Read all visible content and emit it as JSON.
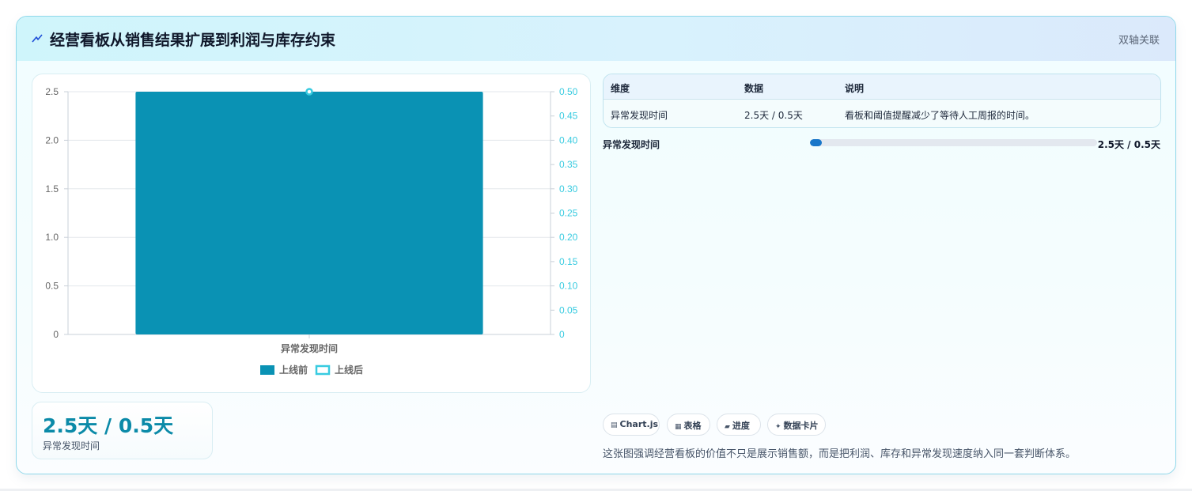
{
  "header": {
    "icon": "spark-icon",
    "title": "经营看板从销售结果扩展到利润与库存约束",
    "badge": "双轴关联"
  },
  "chart_data": {
    "type": "bar",
    "categories": [
      "异常发现时间"
    ],
    "xlabel": "",
    "ylabel": "",
    "ylim": [
      0,
      2.5
    ],
    "y2lim": [
      0,
      0.5
    ],
    "y_ticks": [
      "0",
      "0.5",
      "1.0",
      "1.5",
      "2.0",
      "2.5"
    ],
    "y2_ticks": [
      "0",
      "0.05",
      "0.10",
      "0.15",
      "0.20",
      "0.25",
      "0.30",
      "0.35",
      "0.40",
      "0.45",
      "0.50"
    ],
    "grid": true,
    "legend_position": "bottom",
    "series": [
      {
        "name": "上线前",
        "kind": "bar",
        "axis": "left",
        "values": [
          2.5
        ],
        "color": "#0a92b4"
      },
      {
        "name": "上线后",
        "kind": "line",
        "axis": "right",
        "values": [
          0.5
        ],
        "color": "#38cbe0"
      }
    ]
  },
  "table": {
    "headers": [
      "维度",
      "数据",
      "说明"
    ],
    "rows": [
      [
        "异常发现时间",
        "2.5天 / 0.5天",
        "看板和阈值提醒减少了等待人工周报的时间。"
      ]
    ]
  },
  "progress": {
    "label": "异常发现时间",
    "fraction": 0.04,
    "value": "2.5天 / 0.5天",
    "color": "#1976c9"
  },
  "stat": {
    "value": "2.5天 / 0.5天",
    "label": "异常发现时间"
  },
  "chips": [
    {
      "icon": "▤",
      "label": "Chart.js"
    },
    {
      "icon": "▦",
      "label": "表格"
    },
    {
      "icon": "▰",
      "label": "进度"
    },
    {
      "icon": "✦",
      "label": "数据卡片"
    }
  ],
  "footer_note": "这张图强调经营看板的价值不只是展示销售额，而是把利润、库存和异常发现速度纳入同一套判断体系。"
}
